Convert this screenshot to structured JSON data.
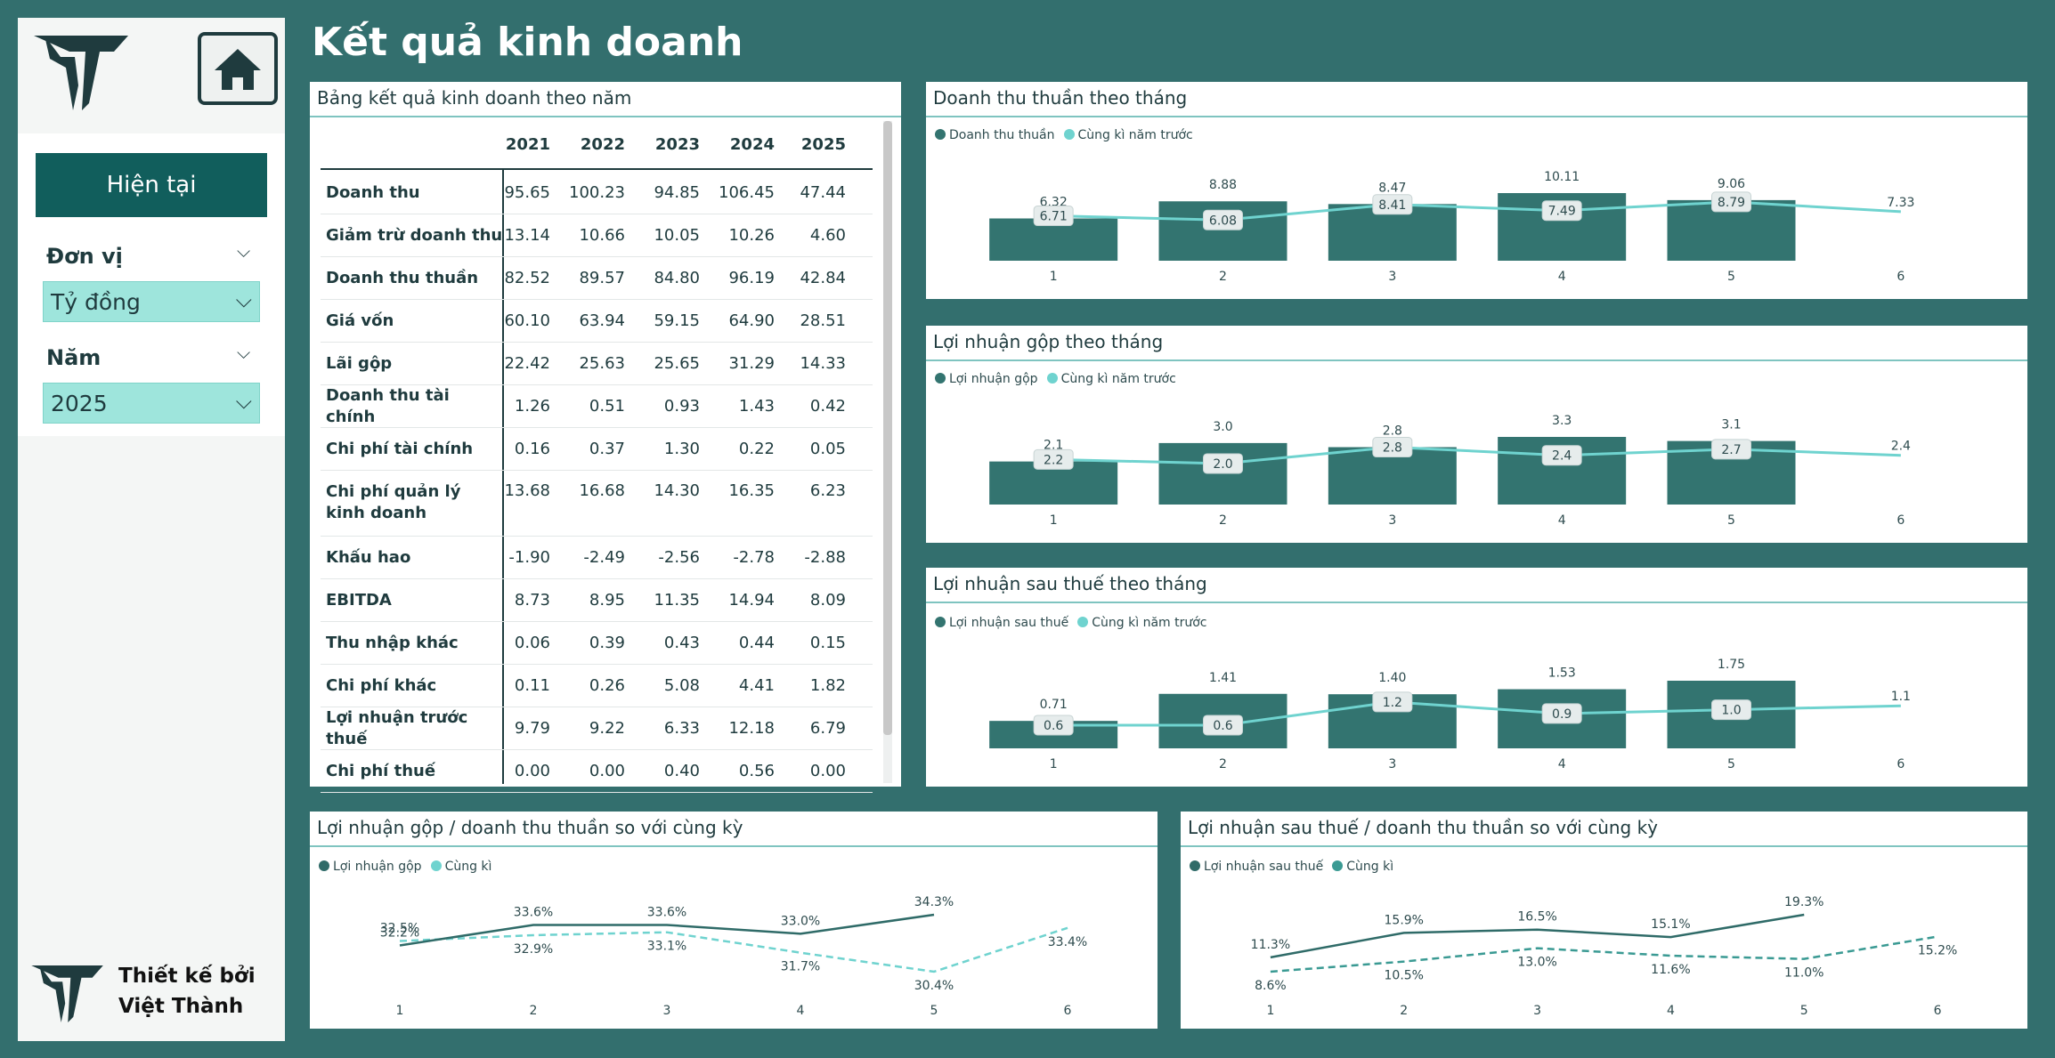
{
  "header": {
    "title": "Kết quả kinh doanh"
  },
  "sidebar": {
    "now_button": "Hiện tại",
    "unit_label": "Đơn vị",
    "unit_value": "Tỷ đồng",
    "year_label": "Năm",
    "year_value": "2025",
    "credit_line1": "Thiết kế bởi",
    "credit_line2": "Việt Thành"
  },
  "table": {
    "title": "Bảng kết quả kinh doanh theo năm",
    "years": [
      "2021",
      "2022",
      "2023",
      "2024",
      "2025"
    ],
    "rows": [
      {
        "name": "Doanh thu",
        "values": [
          "95.65",
          "100.23",
          "94.85",
          "106.45",
          "47.44"
        ]
      },
      {
        "name": "Giảm trừ doanh thu",
        "values": [
          "13.14",
          "10.66",
          "10.05",
          "10.26",
          "4.60"
        ]
      },
      {
        "name": "Doanh thu thuần",
        "values": [
          "82.52",
          "89.57",
          "84.80",
          "96.19",
          "42.84"
        ]
      },
      {
        "name": "Giá vốn",
        "values": [
          "60.10",
          "63.94",
          "59.15",
          "64.90",
          "28.51"
        ]
      },
      {
        "name": "Lãi gộp",
        "values": [
          "22.42",
          "25.63",
          "25.65",
          "31.29",
          "14.33"
        ]
      },
      {
        "name": "Doanh thu tài chính",
        "values": [
          "1.26",
          "0.51",
          "0.93",
          "1.43",
          "0.42"
        ]
      },
      {
        "name": "Chi phí tài chính",
        "values": [
          "0.16",
          "0.37",
          "1.30",
          "0.22",
          "0.05"
        ]
      },
      {
        "name": "Chi phí quản lý kinh doanh",
        "values": [
          "13.68",
          "16.68",
          "14.30",
          "16.35",
          "6.23"
        ]
      },
      {
        "name": "Khấu hao",
        "values": [
          "-1.90",
          "-2.49",
          "-2.56",
          "-2.78",
          "-2.88"
        ]
      },
      {
        "name": "EBITDA",
        "values": [
          "8.73",
          "8.95",
          "11.35",
          "14.94",
          "8.09"
        ]
      },
      {
        "name": "Thu nhập khác",
        "values": [
          "0.06",
          "0.39",
          "0.43",
          "0.44",
          "0.15"
        ]
      },
      {
        "name": "Chi phí khác",
        "values": [
          "0.11",
          "0.26",
          "5.08",
          "4.41",
          "1.82"
        ]
      },
      {
        "name": "Lợi nhuận trước thuế",
        "values": [
          "9.79",
          "9.22",
          "6.33",
          "12.18",
          "6.79"
        ]
      },
      {
        "name": "Chi phí thuế",
        "values": [
          "0.00",
          "0.00",
          "0.40",
          "0.56",
          "0.00"
        ]
      }
    ]
  },
  "chart_data": [
    {
      "type": "bar",
      "title": "Doanh thu thuần theo tháng",
      "categories": [
        "1",
        "2",
        "3",
        "4",
        "5",
        "6"
      ],
      "series": [
        {
          "name": "Doanh thu thuần",
          "values": [
            6.32,
            8.88,
            8.47,
            10.11,
            9.06,
            null
          ]
        },
        {
          "name": "Cùng kì năm trước",
          "values": [
            6.71,
            6.08,
            8.41,
            7.49,
            8.79,
            7.33
          ]
        }
      ],
      "bar_labels": [
        "6.32",
        "8.88",
        "8.47",
        "10.11",
        "9.06",
        ""
      ],
      "line_labels": [
        "6.71",
        "6.08",
        "8.41",
        "7.49",
        "8.79",
        "7.33"
      ],
      "colors": {
        "bar": "#337470",
        "line": "#6fd3cf"
      }
    },
    {
      "type": "bar",
      "title": "Lợi nhuận gộp theo tháng",
      "categories": [
        "1",
        "2",
        "3",
        "4",
        "5",
        "6"
      ],
      "series": [
        {
          "name": "Lợi nhuận gộp",
          "values": [
            2.1,
            3.0,
            2.8,
            3.3,
            3.1,
            null
          ]
        },
        {
          "name": "Cùng kì năm trước",
          "values": [
            2.2,
            2.0,
            2.8,
            2.4,
            2.7,
            2.4
          ]
        }
      ],
      "bar_labels": [
        "2.1",
        "3.0",
        "2.8",
        "3.3",
        "3.1",
        ""
      ],
      "line_labels": [
        "2.2",
        "2.0",
        "2.8",
        "2.4",
        "2.7",
        "2.4"
      ],
      "colors": {
        "bar": "#337470",
        "line": "#6fd3cf"
      }
    },
    {
      "type": "bar",
      "title": "Lợi nhuận sau thuế theo tháng",
      "categories": [
        "1",
        "2",
        "3",
        "4",
        "5",
        "6"
      ],
      "series": [
        {
          "name": "Lợi nhuận sau thuế",
          "values": [
            0.71,
            1.41,
            1.4,
            1.53,
            1.75,
            null
          ]
        },
        {
          "name": "Cùng kì năm trước",
          "values": [
            0.6,
            0.6,
            1.2,
            0.9,
            1.0,
            1.1
          ]
        }
      ],
      "bar_labels": [
        "0.71",
        "1.41",
        "1.40",
        "1.53",
        "1.75",
        ""
      ],
      "line_labels": [
        "0.6",
        "0.6",
        "1.2",
        "0.9",
        "1.0",
        "1.1"
      ],
      "colors": {
        "bar": "#337470",
        "line": "#6fd3cf"
      }
    },
    {
      "type": "line",
      "title": "Lợi nhuận gộp / doanh thu thuần so với cùng kỳ",
      "categories": [
        "1",
        "2",
        "3",
        "4",
        "5",
        "6"
      ],
      "series": [
        {
          "name": "Lợi nhuận gộp",
          "values": [
            32.2,
            33.6,
            33.6,
            33.0,
            34.3,
            null
          ]
        },
        {
          "name": "Cùng kì",
          "values": [
            32.5,
            32.9,
            33.1,
            31.7,
            30.4,
            33.4
          ]
        }
      ],
      "labels_solid": [
        "32.2%",
        "33.6%",
        "33.6%",
        "33.0%",
        "34.3%",
        ""
      ],
      "labels_dashed": [
        "32.5%",
        "32.9%",
        "33.1%",
        "31.7%",
        "30.4%",
        "33.4%"
      ],
      "colors": {
        "solid": "#2f6b68",
        "dashed": "#6fd3cf"
      }
    },
    {
      "type": "line",
      "title": "Lợi nhuận sau thuế / doanh thu thuần so với cùng kỳ",
      "categories": [
        "1",
        "2",
        "3",
        "4",
        "5",
        "6"
      ],
      "series": [
        {
          "name": "Lợi nhuận sau thuế",
          "values": [
            11.3,
            15.9,
            16.5,
            15.1,
            19.3,
            null
          ]
        },
        {
          "name": "Cùng kì",
          "values": [
            8.6,
            10.5,
            13.0,
            11.6,
            11.0,
            15.2
          ]
        }
      ],
      "labels_solid": [
        "11.3%",
        "15.9%",
        "16.5%",
        "15.1%",
        "19.3%",
        ""
      ],
      "labels_dashed": [
        "8.6%",
        "10.5%",
        "13.0%",
        "11.6%",
        "11.0%",
        "15.2%"
      ],
      "colors": {
        "solid": "#2f6b68",
        "dashed": "#3a9a93"
      }
    }
  ]
}
